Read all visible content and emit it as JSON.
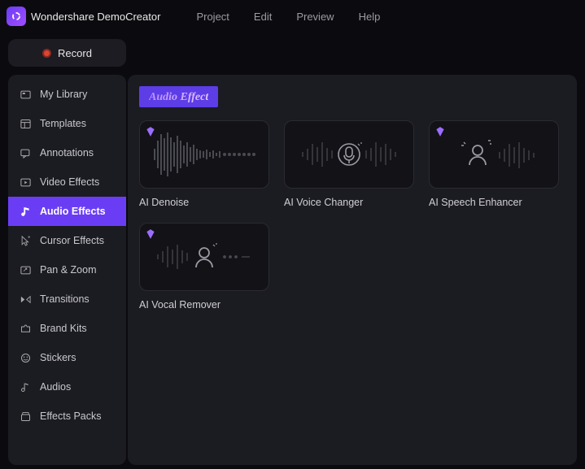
{
  "app": {
    "title": "Wondershare DemoCreator"
  },
  "menu": {
    "project": "Project",
    "edit": "Edit",
    "preview": "Preview",
    "help": "Help"
  },
  "record": {
    "label": "Record"
  },
  "sidebar": {
    "items": [
      {
        "label": "My Library"
      },
      {
        "label": "Templates"
      },
      {
        "label": "Annotations"
      },
      {
        "label": "Video Effects"
      },
      {
        "label": "Audio Effects"
      },
      {
        "label": "Cursor Effects"
      },
      {
        "label": "Pan & Zoom"
      },
      {
        "label": "Transitions"
      },
      {
        "label": "Brand Kits"
      },
      {
        "label": "Stickers"
      },
      {
        "label": "Audios"
      },
      {
        "label": "Effects Packs"
      }
    ]
  },
  "main": {
    "tab": "Audio Effect",
    "cards": [
      {
        "label": "AI Denoise"
      },
      {
        "label": "AI Voice Changer"
      },
      {
        "label": "AI Speech Enhancer"
      },
      {
        "label": "AI Vocal Remover"
      }
    ]
  }
}
